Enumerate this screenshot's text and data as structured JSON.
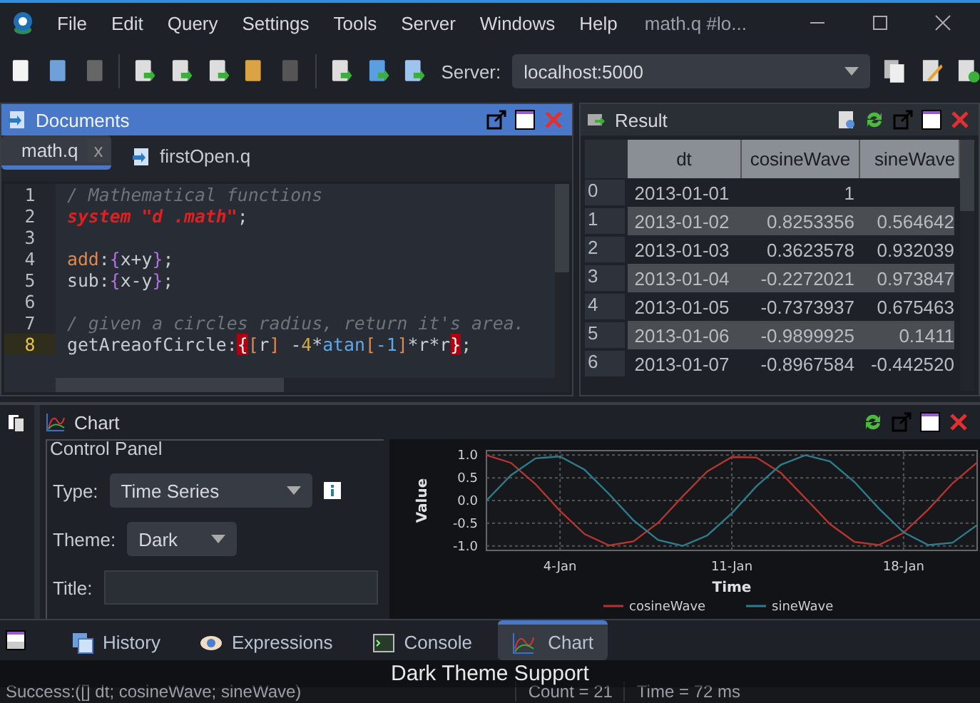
{
  "window": {
    "title": "math.q #lo..."
  },
  "menu": [
    "File",
    "Edit",
    "Query",
    "Settings",
    "Tools",
    "Server",
    "Windows",
    "Help"
  ],
  "toolbar": {
    "server_label": "Server:",
    "server": "localhost:5000"
  },
  "documents": {
    "title": "Documents",
    "tabs": [
      {
        "label": "math.q",
        "selected": true,
        "close": "x"
      },
      {
        "label": "firstOpen.q",
        "selected": false
      }
    ]
  },
  "editor": {
    "lines": [
      {
        "number": "1",
        "current": false,
        "tokens": [
          {
            "kind": "comment",
            "text": "/ Mathematical functions"
          }
        ]
      },
      {
        "number": "2",
        "current": false,
        "tokens": [
          {
            "kind": "system",
            "text": "system \"d .math\""
          },
          {
            "kind": "plain",
            "text": ";"
          }
        ]
      },
      {
        "number": "3",
        "current": false
      },
      {
        "number": "4",
        "current": false,
        "tokens": [
          {
            "kind": "name",
            "text": "add"
          },
          {
            "kind": "plain",
            "text": ":"
          },
          {
            "kind": "brace",
            "text": "{"
          },
          {
            "kind": "plain",
            "text": "x+y"
          },
          {
            "kind": "brace",
            "text": "}"
          },
          {
            "kind": "plain",
            "text": ";"
          }
        ]
      },
      {
        "number": "5",
        "current": false,
        "tokens": [
          {
            "kind": "plain",
            "text": "sub:"
          },
          {
            "kind": "brace",
            "text": "{"
          },
          {
            "kind": "plain",
            "text": "x-y"
          },
          {
            "kind": "brace",
            "text": "}"
          },
          {
            "kind": "plain",
            "text": ";"
          }
        ]
      },
      {
        "number": "6",
        "current": false
      },
      {
        "number": "7",
        "current": false,
        "tokens": [
          {
            "kind": "comment",
            "text": "/ given a circles radius, return it's area."
          }
        ]
      },
      {
        "number": "8",
        "current": true,
        "tokens": [
          {
            "kind": "plain",
            "text": "getAreaofCircle:"
          },
          {
            "kind": "match",
            "text": "{"
          },
          {
            "kind": "bracket",
            "text": "["
          },
          {
            "kind": "plain",
            "text": "r"
          },
          {
            "kind": "bracket",
            "text": "]"
          },
          {
            "kind": "plain",
            "text": " -"
          },
          {
            "kind": "number",
            "text": "4"
          },
          {
            "kind": "plain",
            "text": "*"
          },
          {
            "kind": "function",
            "text": "atan"
          },
          {
            "kind": "bracket",
            "text": "["
          },
          {
            "kind": "function",
            "text": "-1"
          },
          {
            "kind": "bracket",
            "text": "]"
          },
          {
            "kind": "plain",
            "text": "*r*r"
          },
          {
            "kind": "match",
            "text": "}"
          },
          {
            "kind": "plain",
            "text": ";"
          }
        ]
      }
    ]
  },
  "result": {
    "title": "Result",
    "columns": [
      "dt",
      "cosineWave",
      "sineWave"
    ],
    "rows": [
      {
        "index": "0",
        "cells": [
          "2013-01-01",
          "1"
        ]
      },
      {
        "index": "1",
        "cells": [
          "2013-01-02",
          "0.8253356",
          "0.564642"
        ]
      },
      {
        "index": "2",
        "cells": [
          "2013-01-03",
          "0.3623578",
          "0.932039"
        ]
      },
      {
        "index": "3",
        "cells": [
          "2013-01-04",
          "-0.2272021",
          "0.973847"
        ]
      },
      {
        "index": "4",
        "cells": [
          "2013-01-05",
          "-0.7373937",
          "0.675463"
        ]
      },
      {
        "index": "5",
        "cells": [
          "2013-01-06",
          "-0.9899925",
          "0.1411"
        ]
      },
      {
        "index": "6",
        "cells": [
          "2013-01-07",
          "-0.8967584",
          "-0.442520"
        ]
      }
    ]
  },
  "chart_panel": {
    "title": "Chart",
    "control_panel": {
      "legend": "Control Panel",
      "type_label": "Type:",
      "type": "Time Series",
      "theme_label": "Theme:",
      "theme": "Dark",
      "title_label": "Title:"
    },
    "chart_data": {
      "type": "line",
      "xlabel": "Time",
      "ylabel": "Value",
      "categories": [
        null,
        null,
        null,
        "4-Jan",
        null,
        null,
        null,
        null,
        null,
        null,
        "11-Jan",
        null,
        null,
        null,
        null,
        null,
        null,
        "18-Jan",
        null,
        null,
        null
      ],
      "series": [
        {
          "name": "cosineWave",
          "color": "#b3362f",
          "values": [
            1,
            0.83,
            0.36,
            -0.23,
            -0.74,
            -0.99,
            -0.9,
            -0.49,
            0.09,
            0.64,
            0.96,
            0.95,
            0.61,
            0.05,
            -0.52,
            -0.91,
            -0.98,
            -0.71,
            -0.2,
            0.38,
            0.84
          ]
        },
        {
          "name": "sineWave",
          "color": "#2e7d8c",
          "values": [
            0,
            0.56,
            0.93,
            0.97,
            0.68,
            0.14,
            -0.44,
            -0.87,
            -1,
            -0.77,
            -0.28,
            0.31,
            0.79,
            1,
            0.86,
            0.41,
            -0.18,
            -0.7,
            -0.98,
            -0.93,
            -0.54
          ]
        }
      ],
      "ylim": [
        -1.1,
        1.1
      ],
      "grid": true,
      "legend": "bottom",
      "yticks": [
        {
          "value": 1,
          "label": "1.0"
        },
        {
          "value": 0.5,
          "label": "0.5"
        },
        {
          "value": 0,
          "label": "0.0"
        },
        {
          "value": -0.5,
          "label": "-0.5"
        },
        {
          "value": -1,
          "label": "-1.0"
        }
      ]
    }
  },
  "bottom_tabs": [
    {
      "label": "History",
      "selected": false
    },
    {
      "label": "Expressions",
      "selected": false
    },
    {
      "label": "Console",
      "selected": false
    },
    {
      "label": "Chart",
      "selected": true
    }
  ],
  "status_bar": {
    "message": "Success:([] dt; cosineWave; sineWave)",
    "count": "Count = 21",
    "time": "Time = 72 ms"
  },
  "caption": "Dark Theme Support"
}
